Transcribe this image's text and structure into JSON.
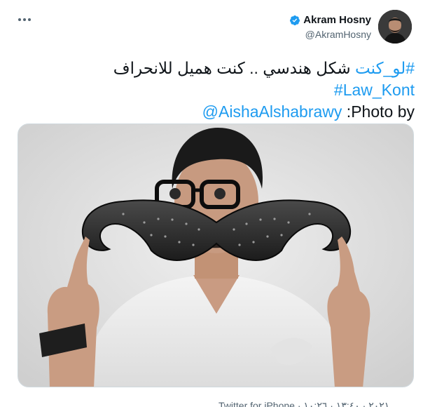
{
  "author": {
    "display_name": "Akram Hosny",
    "handle": "@AkramHosny",
    "verified": true,
    "avatar_alt": "profile photo"
  },
  "tweet": {
    "hashtag_1": "#لو_كنت",
    "line_1_text": " شكل هندسي .. كنت هميل للانحراف",
    "hashtag_2": "#Law_Kont",
    "photo_by_label": "Photo by: ",
    "photo_by_mention": "@AishaAlshabrawy"
  },
  "media": {
    "description": "photo"
  },
  "footer": {
    "meta": "Twitter for iPhone · ٢٠٢١ · ١٣:٤٠ · ١٠:٢٦"
  },
  "colors": {
    "link": "#1d9bf0",
    "text": "#0f1419",
    "secondary": "#536471",
    "verified": "#1d9bf0"
  },
  "icons": {
    "more": "more-icon",
    "verified": "verified-badge-icon"
  }
}
